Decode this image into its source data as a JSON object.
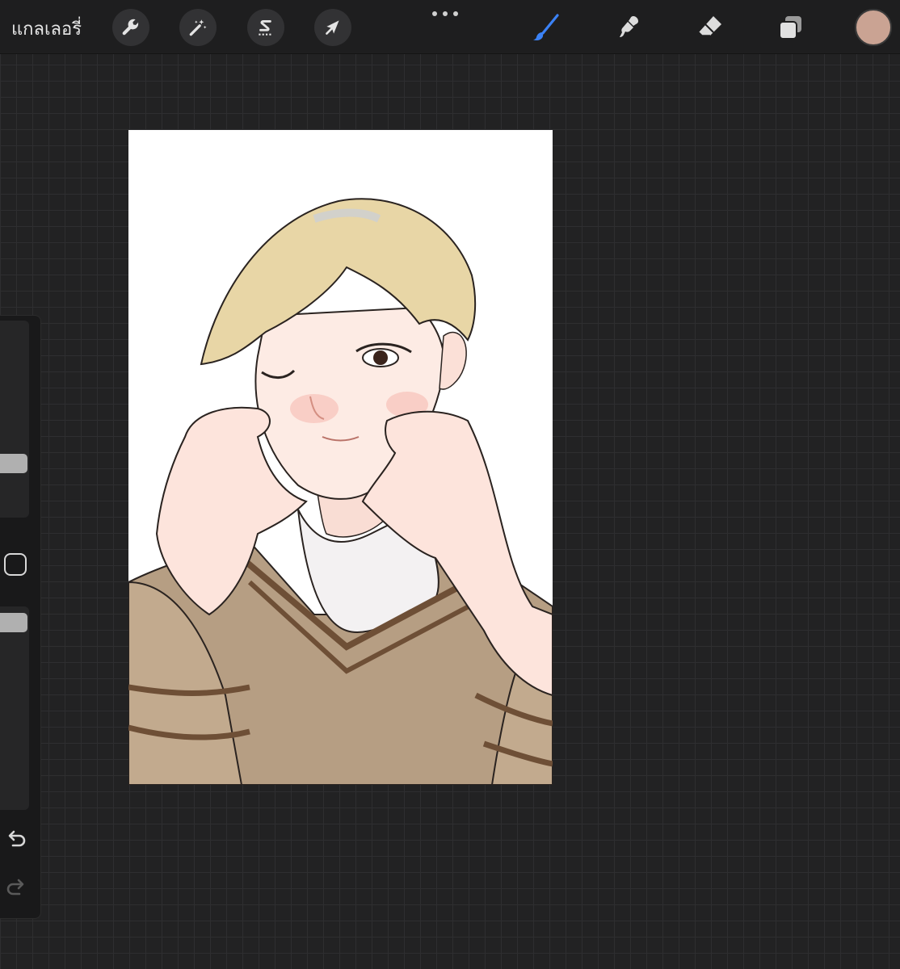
{
  "topbar": {
    "gallery_label": "แกลเลอรี่",
    "tools_left": [
      "actions-wrench-icon",
      "adjustments-magic-wand-icon",
      "selection-s-icon",
      "transform-arrow-icon"
    ],
    "more_menu": "more-dots-icon",
    "tools_right": [
      "brush-icon",
      "smudge-icon",
      "eraser-icon",
      "layers-icon"
    ],
    "active_tool": "brush",
    "active_tool_color": "#3b82f6",
    "current_color": "#caa393"
  },
  "sidebar": {
    "brush_size": "slider",
    "opacity": "slider",
    "modify_button": "square-icon",
    "undo": "undo-icon",
    "redo": "redo-icon"
  },
  "canvas": {
    "background": "#ffffff",
    "artwork": "illustration-blonde-person-winking-brown-sweater"
  }
}
